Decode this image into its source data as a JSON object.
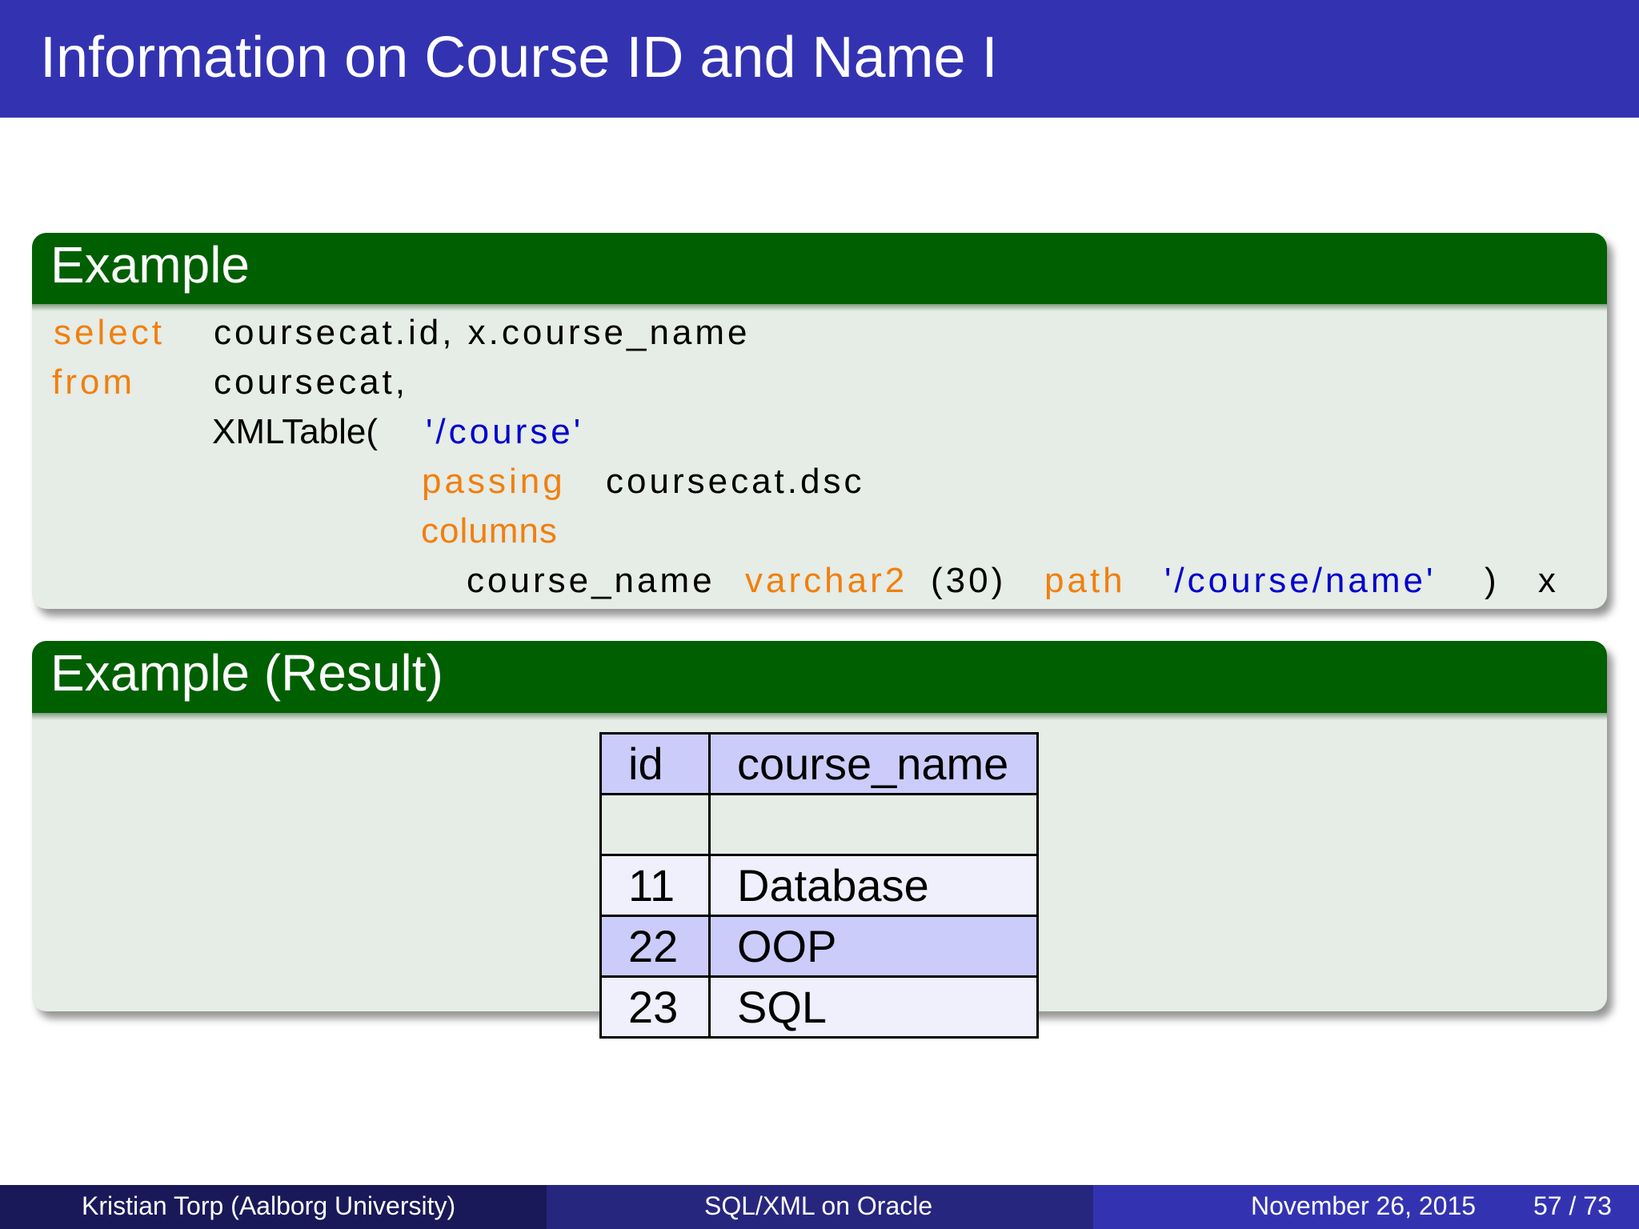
{
  "slide": {
    "title": "Information on Course ID and Name I"
  },
  "example_block": {
    "title": "Example",
    "code": {
      "kw_select": "select",
      "line1_rest": "coursecat.id, x.course_name",
      "kw_from": "from",
      "line2_rest": "coursecat,",
      "line3_fn": "XMLTable(",
      "line3_str": "'/course'",
      "kw_passing": "passing",
      "line4_rest": "coursecat.dsc",
      "kw_columns": "columns",
      "line6_col": "course_name",
      "kw_varchar2": "varchar2",
      "line6_size": "(30)",
      "kw_path": "path",
      "line6_str": "'/course/name'",
      "line6_end": ") x"
    }
  },
  "result_block": {
    "title": "Example (Result)",
    "table": {
      "headers": [
        "id",
        "course_name"
      ],
      "rows": [
        [
          "11",
          "Database"
        ],
        [
          "22",
          "OOP"
        ],
        [
          "23",
          "SQL"
        ]
      ]
    }
  },
  "footer": {
    "author": "Kristian Torp  (Aalborg University)",
    "topic": "SQL/XML on Oracle",
    "date": "November 26, 2015",
    "page": "57 / 73"
  }
}
